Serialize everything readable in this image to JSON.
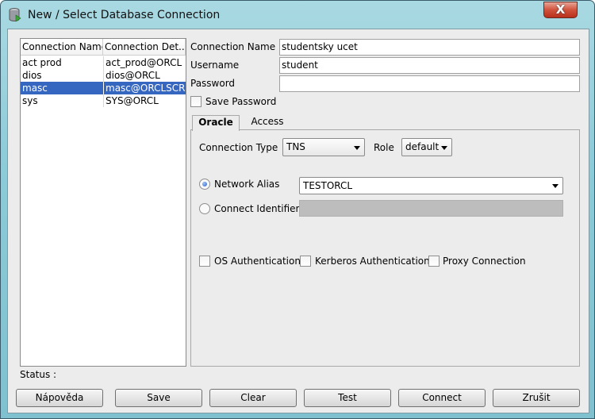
{
  "window": {
    "title": "New / Select Database Connection",
    "close_label": "X"
  },
  "list": {
    "columns": [
      "Connection Name",
      "Connection Det..."
    ],
    "rows": [
      {
        "name": "act prod",
        "details": "act_prod@ORCL"
      },
      {
        "name": "dios",
        "details": "dios@ORCL"
      },
      {
        "name": "masc",
        "details": "masc@ORCLSCR"
      },
      {
        "name": "sys",
        "details": "SYS@ORCL"
      }
    ],
    "selected": "masc"
  },
  "form": {
    "connection_name_label": "Connection Name",
    "connection_name": "studentsky ucet",
    "username_label": "Username",
    "username": "student",
    "password_label": "Password",
    "password": "",
    "save_password_label": "Save Password",
    "save_password": false
  },
  "tabs": [
    {
      "label": "Oracle",
      "active": true
    },
    {
      "label": "Access",
      "active": false
    }
  ],
  "oracle": {
    "connection_type_label": "Connection Type",
    "connection_type": "TNS",
    "role_label": "Role",
    "role": "default",
    "network_alias_label": "Network Alias",
    "network_alias": "TESTORCL",
    "connect_identifier_label": "Connect Identifier",
    "connect_identifier": "",
    "selected_option": "Network Alias",
    "os_auth_label": "OS Authentication",
    "kerberos_label": "Kerberos Authentication",
    "proxy_label": "Proxy Connection"
  },
  "status": {
    "label": "Status :"
  },
  "buttons": {
    "help": "Nápověda",
    "save": "Save",
    "clear": "Clear",
    "test": "Test",
    "connect": "Connect",
    "cancel": "Zrušit"
  }
}
